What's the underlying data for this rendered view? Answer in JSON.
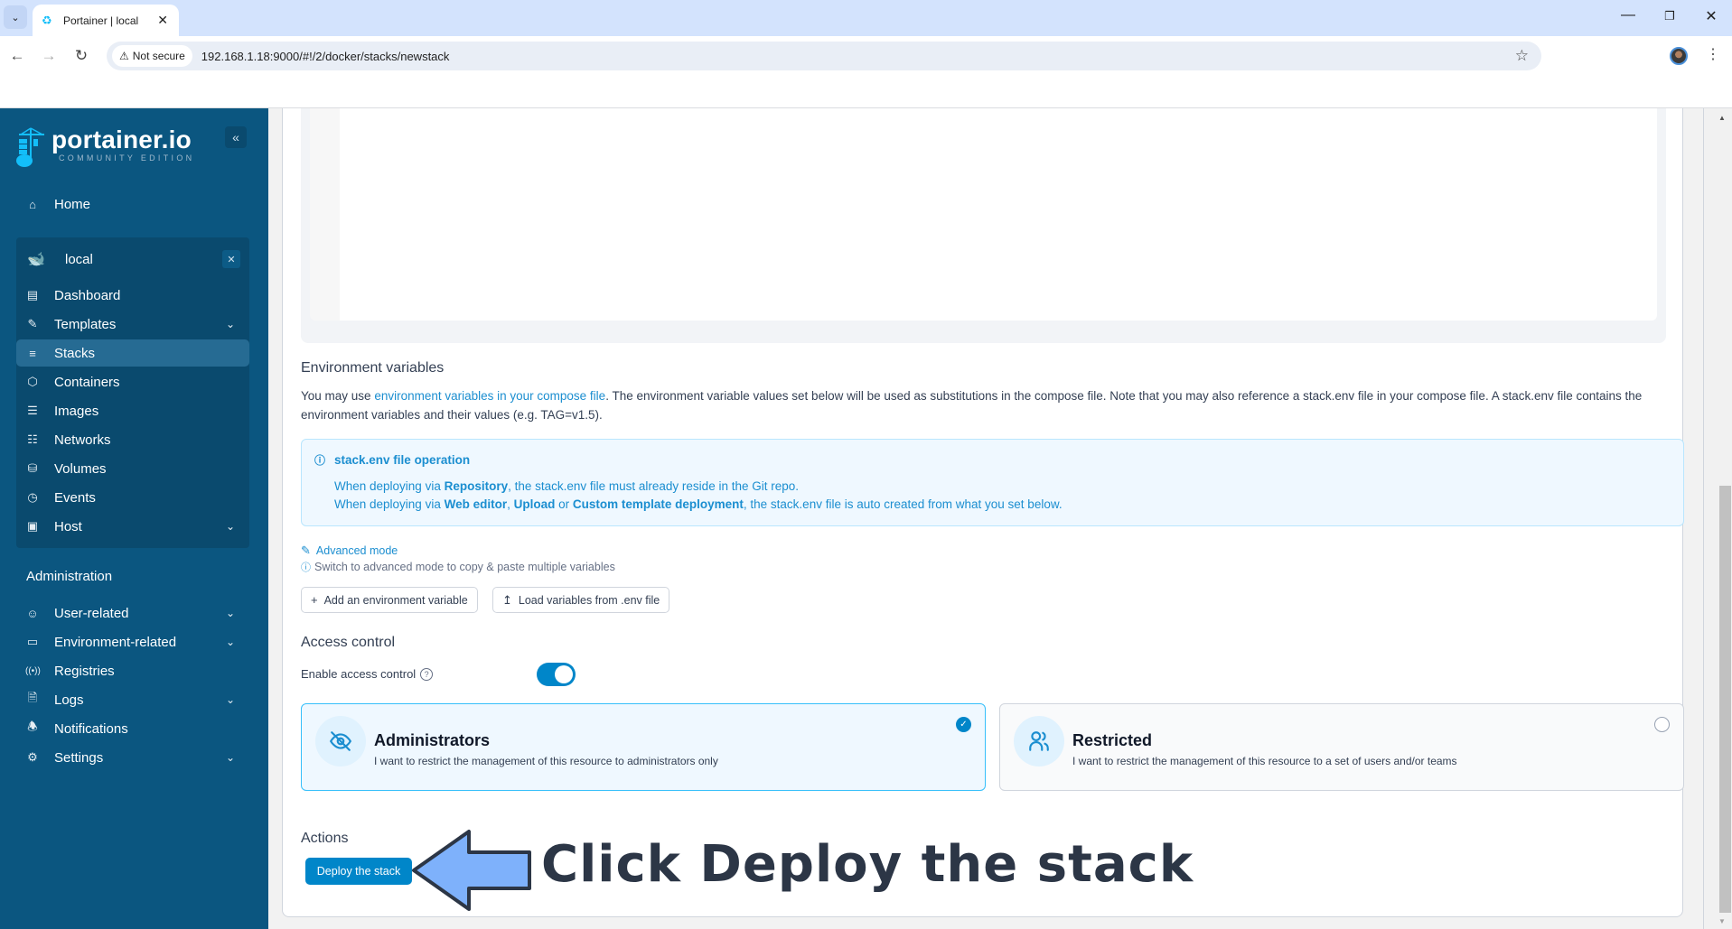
{
  "browser": {
    "tab_title": "Portainer | local",
    "security_label": "Not secure",
    "url": "192.168.1.18:9000/#!/2/docker/stacks/newstack"
  },
  "sidebar": {
    "logo_title": "portainer.io",
    "logo_subtitle": "COMMUNITY EDITION",
    "home": "Home",
    "environment": {
      "name": "local",
      "items": [
        {
          "label": "Dashboard",
          "icon": "dashboard-icon"
        },
        {
          "label": "Templates",
          "icon": "edit-icon",
          "expandable": true
        },
        {
          "label": "Stacks",
          "icon": "layers-icon",
          "active": true
        },
        {
          "label": "Containers",
          "icon": "box-icon"
        },
        {
          "label": "Images",
          "icon": "list-icon"
        },
        {
          "label": "Networks",
          "icon": "network-icon"
        },
        {
          "label": "Volumes",
          "icon": "database-icon"
        },
        {
          "label": "Events",
          "icon": "clock-icon"
        },
        {
          "label": "Host",
          "icon": "host-icon",
          "expandable": true
        }
      ]
    },
    "admin_heading": "Administration",
    "admin_items": [
      {
        "label": "User-related",
        "icon": "users-icon",
        "expandable": true
      },
      {
        "label": "Environment-related",
        "icon": "server-icon",
        "expandable": true
      },
      {
        "label": "Registries",
        "icon": "radio-icon"
      },
      {
        "label": "Logs",
        "icon": "file-text-icon",
        "expandable": true
      },
      {
        "label": "Notifications",
        "icon": "bell-icon"
      },
      {
        "label": "Settings",
        "icon": "gear-icon",
        "expandable": true
      }
    ]
  },
  "env_vars": {
    "title": "Environment variables",
    "intro_prefix": "You may use ",
    "intro_link": "environment variables in your compose file",
    "intro_suffix": ". The environment variable values set below will be used as substitutions in the compose file. Note that you may also reference a stack.env file in your compose file. A stack.env file contains the environment variables and their values (e.g. TAG=v1.5).",
    "info_title": "stack.env file operation",
    "info_line1_a": "When deploying via ",
    "info_line1_b": "Repository",
    "info_line1_c": ", the stack.env file must already reside in the Git repo.",
    "info_line2_a": "When deploying via ",
    "info_line2_b": "Web editor",
    "info_line2_c": ", ",
    "info_line2_d": "Upload",
    "info_line2_e": " or ",
    "info_line2_f": "Custom template deployment",
    "info_line2_g": ", the stack.env file is auto created from what you set below.",
    "advanced_mode": "Advanced mode",
    "advanced_hint": "Switch to advanced mode to copy & paste multiple variables",
    "add_button": "Add an environment variable",
    "load_button": "Load variables from .env file"
  },
  "access_control": {
    "title": "Access control",
    "enable_label": "Enable access control",
    "enabled": true,
    "options": [
      {
        "title": "Administrators",
        "description": "I want to restrict the management of this resource to administrators only",
        "selected": true
      },
      {
        "title": "Restricted",
        "description": "I want to restrict the management of this resource to a set of users and/or teams",
        "selected": false
      }
    ]
  },
  "actions": {
    "title": "Actions",
    "deploy_button": "Deploy the stack"
  },
  "annotation": {
    "text": "Click Deploy the stack",
    "arrow_color": "#7eb1fb"
  },
  "colors": {
    "sidebar_bg": "#0b5680",
    "primary": "#0086c9",
    "link": "#1b8ed0"
  }
}
